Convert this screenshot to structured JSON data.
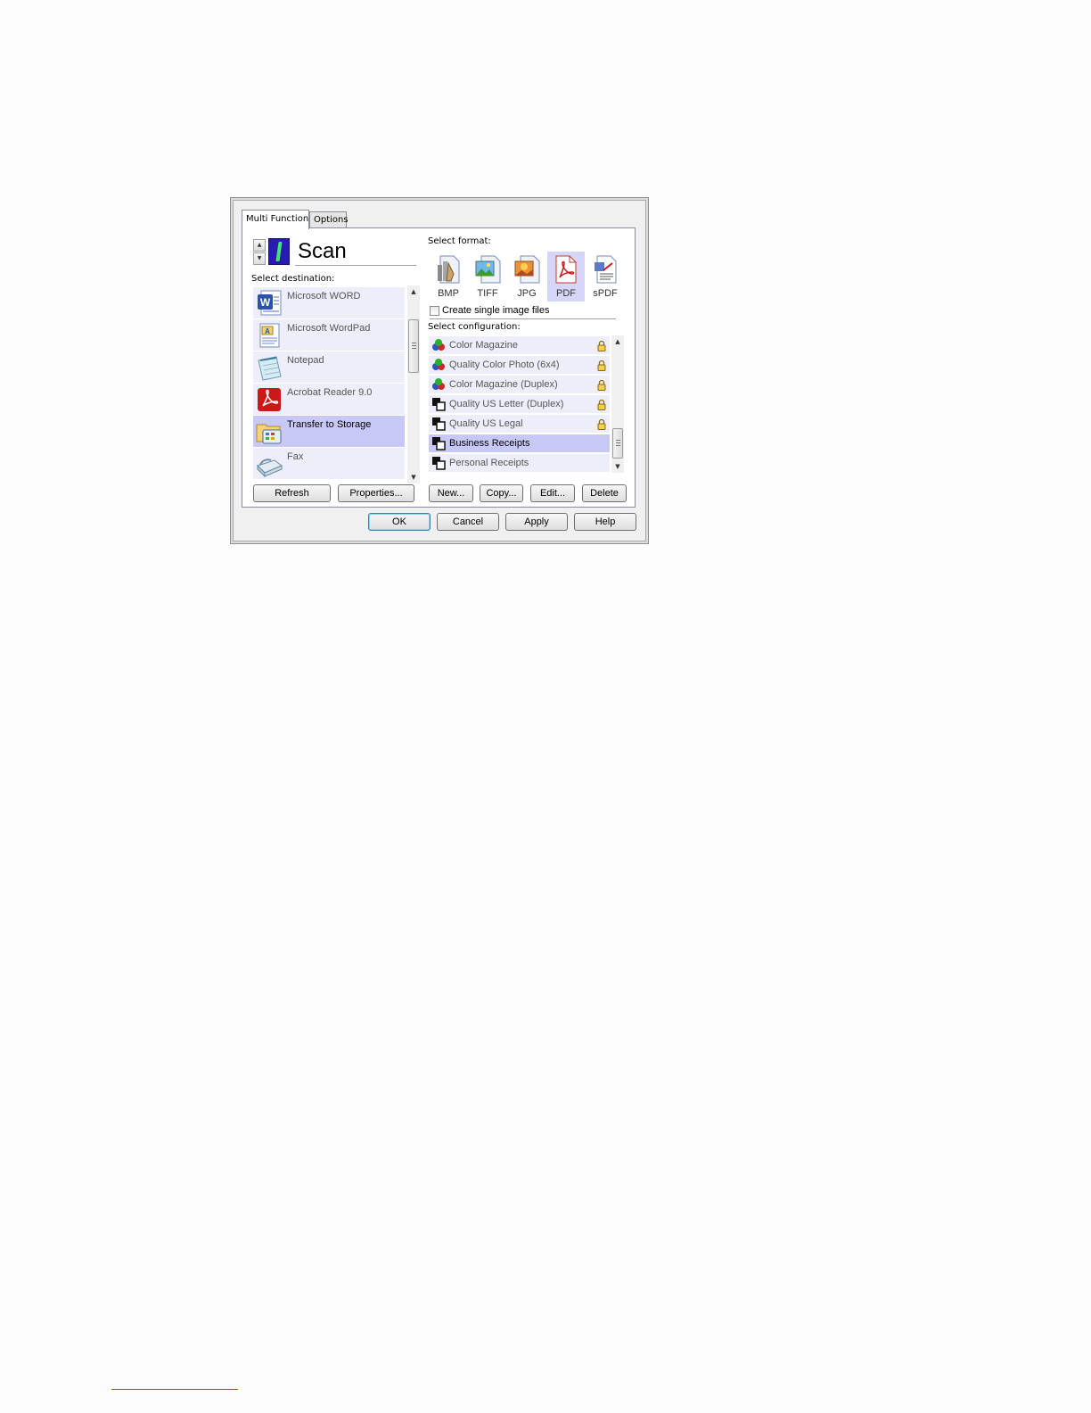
{
  "tabs": [
    {
      "label": "Multi Function",
      "active": true
    },
    {
      "label": "Options",
      "active": false
    }
  ],
  "button_number": "1",
  "scan_title": "Scan",
  "destination": {
    "label": "Select destination:",
    "items": [
      {
        "label": "Microsoft WORD",
        "icon": "word-icon",
        "selected": false
      },
      {
        "label": "Microsoft WordPad",
        "icon": "wordpad-icon",
        "selected": false
      },
      {
        "label": "Notepad",
        "icon": "notepad-icon",
        "selected": false
      },
      {
        "label": "Acrobat Reader 9.0",
        "icon": "acrobat-icon",
        "selected": false
      },
      {
        "label": "Transfer to Storage",
        "icon": "storage-folder-icon",
        "selected": true
      },
      {
        "label": "Fax",
        "icon": "fax-icon",
        "selected": false
      }
    ],
    "refresh_label": "Refresh",
    "properties_label": "Properties..."
  },
  "format": {
    "label": "Select format:",
    "items": [
      {
        "label": "BMP",
        "icon": "bmp-icon",
        "selected": false
      },
      {
        "label": "TIFF",
        "icon": "tiff-icon",
        "selected": false
      },
      {
        "label": "JPG",
        "icon": "jpg-icon",
        "selected": false
      },
      {
        "label": "PDF",
        "icon": "pdf-icon",
        "selected": true
      },
      {
        "label": "sPDF",
        "icon": "spdf-icon",
        "selected": false
      }
    ],
    "single_image_label": "Create single image files",
    "single_image_checked": false
  },
  "configuration": {
    "label": "Select configuration:",
    "items": [
      {
        "label": "Color Magazine",
        "icon": "color-config-icon",
        "locked": true,
        "selected": false
      },
      {
        "label": "Quality Color Photo (6x4)",
        "icon": "color-config-icon",
        "locked": true,
        "selected": false
      },
      {
        "label": "Color Magazine (Duplex)",
        "icon": "color-config-icon",
        "locked": true,
        "selected": false
      },
      {
        "label": "Quality US Letter (Duplex)",
        "icon": "bw-config-icon",
        "locked": true,
        "selected": false
      },
      {
        "label": "Quality US Legal",
        "icon": "bw-config-icon",
        "locked": true,
        "selected": false
      },
      {
        "label": "Business Receipts",
        "icon": "bw-config-icon",
        "locked": false,
        "selected": true
      },
      {
        "label": "Personal Receipts",
        "icon": "bw-config-icon",
        "locked": false,
        "selected": false
      }
    ],
    "new_label": "New...",
    "copy_label": "Copy...",
    "edit_label": "Edit...",
    "delete_label": "Delete"
  },
  "dialog_buttons": {
    "ok_label": "OK",
    "cancel_label": "Cancel",
    "apply_label": "Apply",
    "help_label": "Help"
  },
  "colors": {
    "list_bg": "#eeeefb",
    "selected_bg": "#c8c8f6",
    "digit_bg": "#2a1bb0",
    "digit_fg": "#3de86b"
  }
}
